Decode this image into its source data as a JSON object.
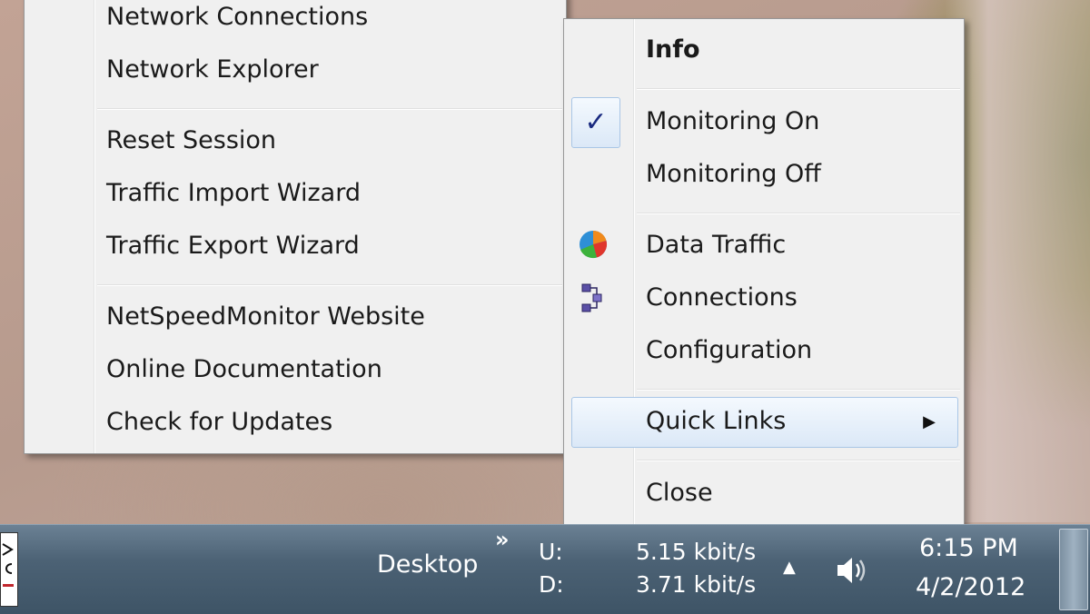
{
  "quick_links_menu": {
    "items": [
      {
        "label": "Network Connections"
      },
      {
        "label": "Network Explorer"
      },
      {
        "label": "Reset Session"
      },
      {
        "label": "Traffic Import Wizard"
      },
      {
        "label": "Traffic Export Wizard"
      },
      {
        "label": "NetSpeedMonitor Website"
      },
      {
        "label": "Online Documentation"
      },
      {
        "label": "Check for Updates"
      }
    ]
  },
  "context_menu": {
    "info": "Info",
    "monitoring_on": "Monitoring On",
    "monitoring_off": "Monitoring Off",
    "data_traffic": "Data Traffic",
    "connections": "Connections",
    "configuration": "Configuration",
    "quick_links": "Quick Links",
    "close": "Close",
    "check_glyph": "✓",
    "submenu_arrow_glyph": "▶",
    "monitoring_on_checked": true,
    "icons": {
      "data_traffic": "pie-chart-icon",
      "connections": "network-connections-icon"
    }
  },
  "taskbar": {
    "toolbar_label": "Desktop",
    "toolbar_chevron": "»",
    "upload_label": "U:",
    "download_label": "D:",
    "upload_speed": "5.15 kbit/s",
    "download_speed": "3.71 kbit/s",
    "tray_expand_glyph": "▲",
    "time": "6:15 PM",
    "date": "4/2/2012"
  },
  "colors": {
    "menu_background": "#f0f0f0",
    "check_color": "#1a2a80",
    "taskbar": "#4c6275"
  }
}
